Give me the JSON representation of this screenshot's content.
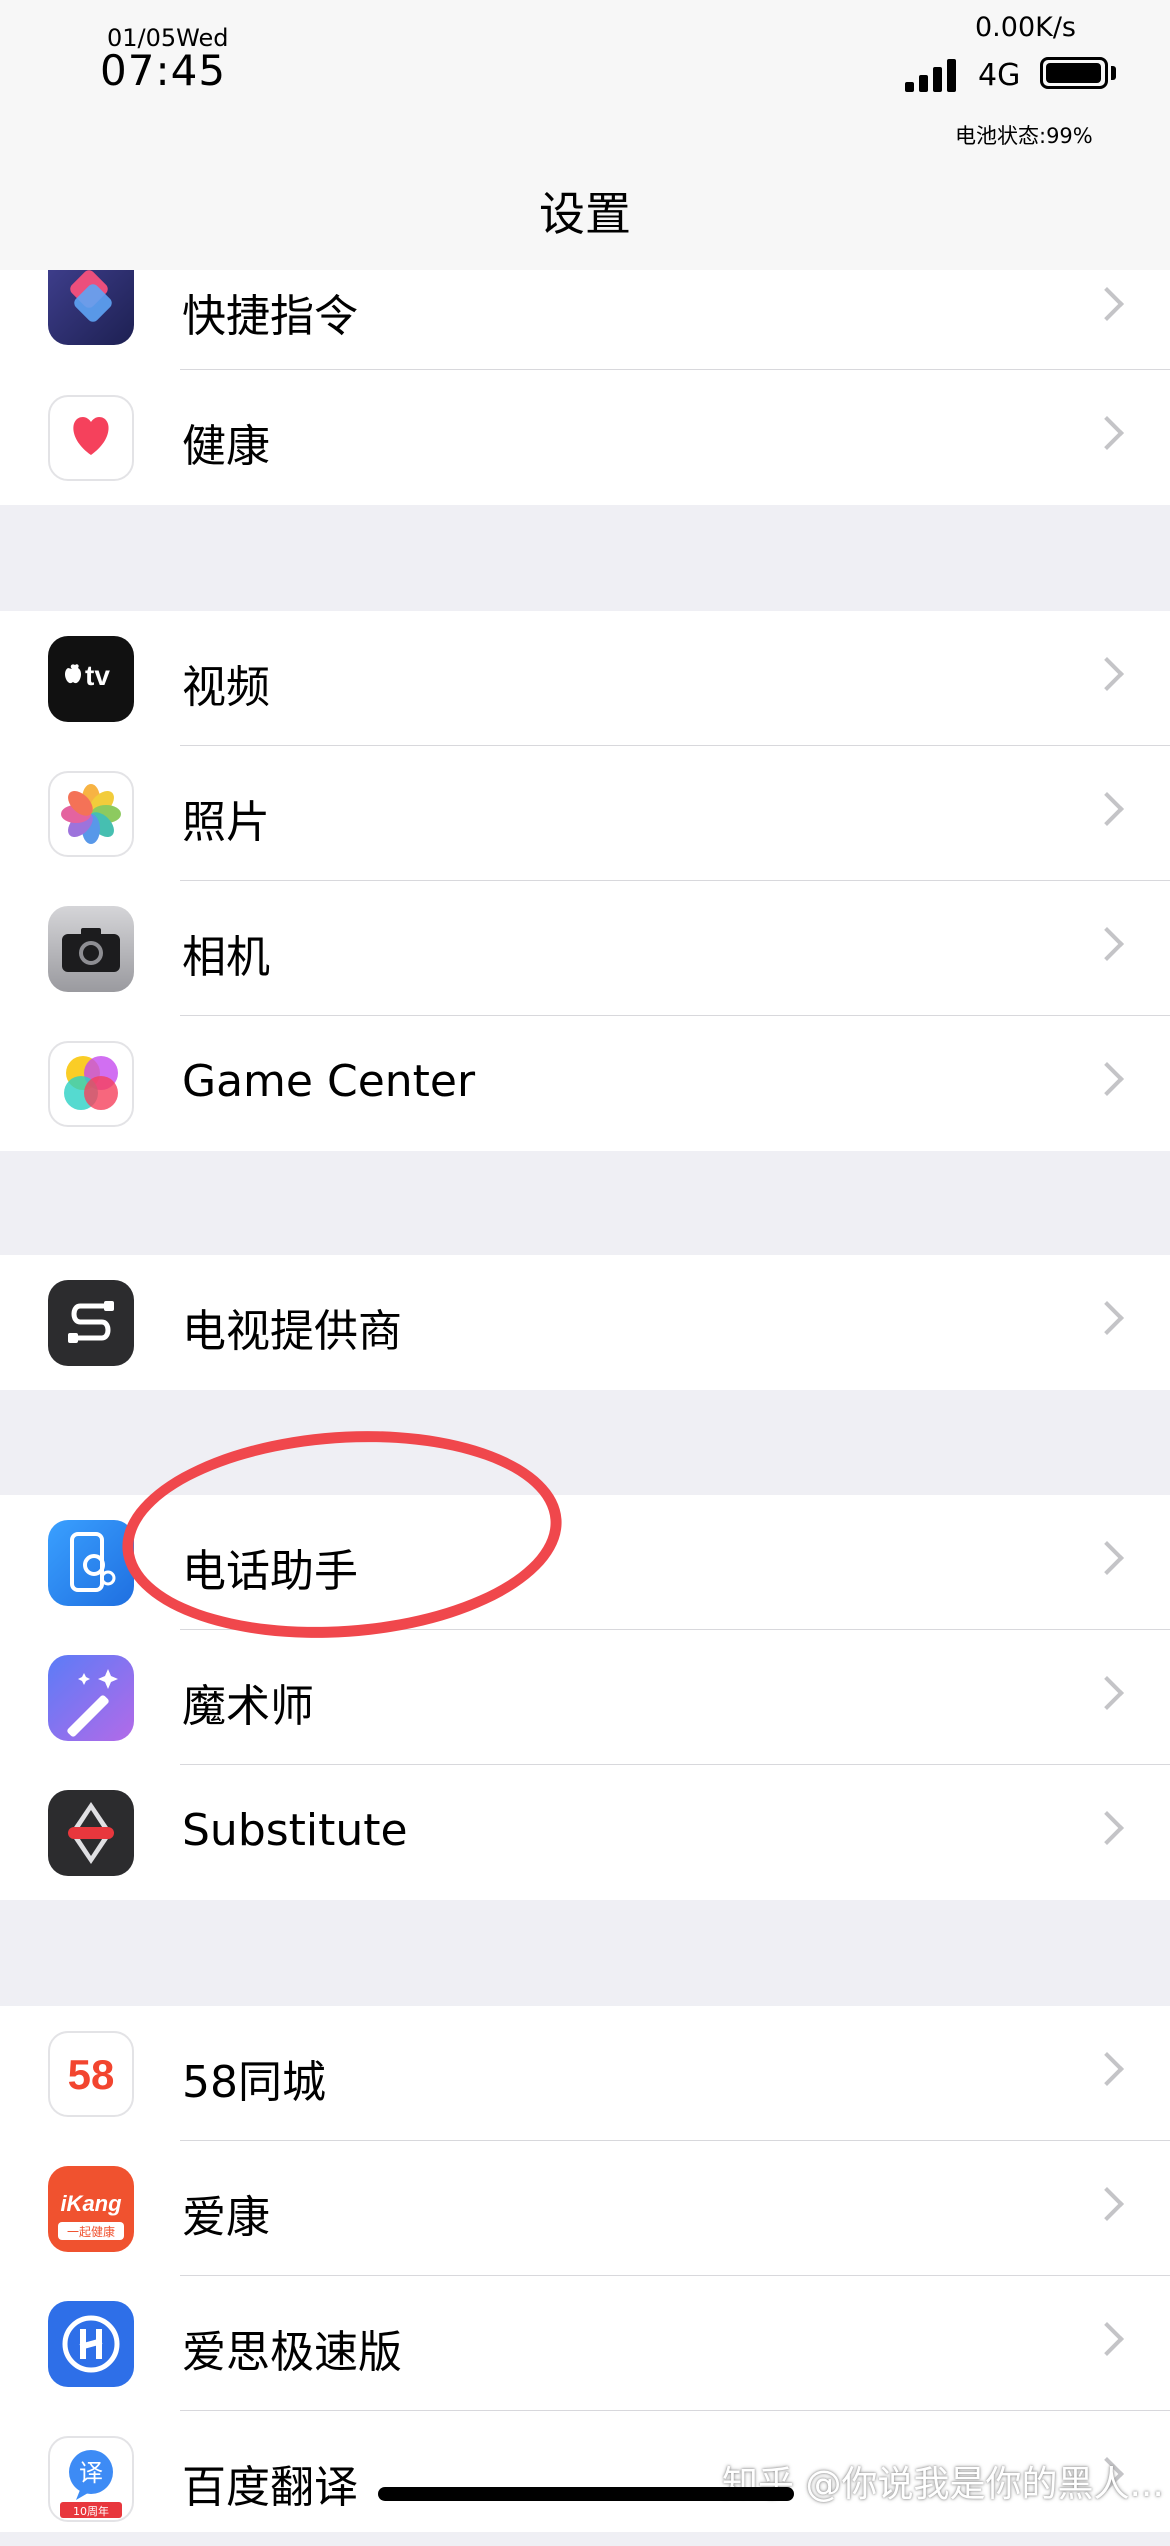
{
  "status_bar": {
    "date": "01/05Wed",
    "time": "07:45",
    "net_speed": "0.00K/s",
    "network": "4G",
    "battery_status": "电池状态:99%",
    "battery_level": 0.99
  },
  "header": {
    "title": "设置"
  },
  "groups": [
    {
      "items": [
        {
          "label": "快捷指令",
          "icon": "shortcuts-icon"
        },
        {
          "label": "健康",
          "icon": "health-icon"
        }
      ]
    },
    {
      "items": [
        {
          "label": "视频",
          "icon": "apple-tv-icon",
          "icon_text": "tv"
        },
        {
          "label": "照片",
          "icon": "photos-icon"
        },
        {
          "label": "相机",
          "icon": "camera-icon"
        },
        {
          "label": "Game Center",
          "icon": "game-center-icon"
        }
      ]
    },
    {
      "items": [
        {
          "label": "电视提供商",
          "icon": "tv-provider-icon"
        }
      ]
    },
    {
      "items": [
        {
          "label": "电话助手",
          "icon": "phone-assistant-icon"
        },
        {
          "label": "魔术师",
          "icon": "magic-wand-icon"
        },
        {
          "label": "Substitute",
          "icon": "substitute-icon"
        }
      ]
    },
    {
      "items": [
        {
          "label": "58同城",
          "icon": "58-tongcheng-icon",
          "icon_text": "58"
        },
        {
          "label": "爱康",
          "icon": "ikang-icon",
          "icon_text": "iKang",
          "icon_subtext": "一起健康"
        },
        {
          "label": "爱思极速版",
          "icon": "i4-icon"
        },
        {
          "label": "百度翻译",
          "icon": "baidu-translate-icon",
          "icon_text": "译",
          "icon_subtext": "10周年"
        }
      ]
    }
  ],
  "annotation": {
    "color": "#f0474c",
    "shape": "hand-drawn-ellipse"
  },
  "watermark": "知乎 @你说我是你的黑人...",
  "colors": {
    "background": "#efeff4",
    "chevron": "#c4c4c7",
    "annotation": "#f0474c"
  }
}
